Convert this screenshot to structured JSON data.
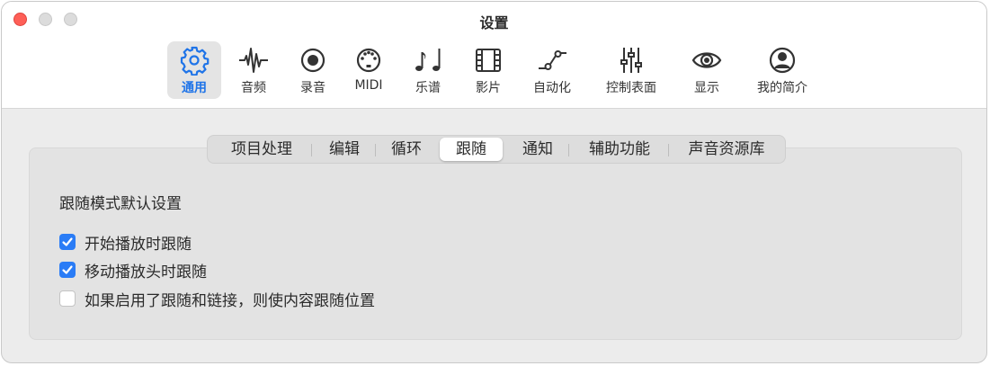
{
  "window": {
    "title": "设置"
  },
  "toolbar": {
    "items": [
      {
        "label": "通用",
        "icon": "gear-icon",
        "active": true
      },
      {
        "label": "音频",
        "icon": "waveform-icon"
      },
      {
        "label": "录音",
        "icon": "record-icon"
      },
      {
        "label": "MIDI",
        "icon": "midi-icon"
      },
      {
        "label": "乐谱",
        "icon": "music-notes-icon"
      },
      {
        "label": "影片",
        "icon": "film-icon"
      },
      {
        "label": "自动化",
        "icon": "automation-icon"
      },
      {
        "label": "控制表面",
        "icon": "sliders-icon"
      },
      {
        "label": "显示",
        "icon": "eye-icon"
      },
      {
        "label": "我的简介",
        "icon": "person-icon"
      }
    ]
  },
  "tabs": {
    "items": [
      "项目处理",
      "编辑",
      "循环",
      "跟随",
      "通知",
      "辅助功能",
      "声音资源库"
    ],
    "selected": "跟随"
  },
  "section": {
    "title": "跟随模式默认设置",
    "options": [
      {
        "label": "开始播放时跟随",
        "checked": true
      },
      {
        "label": "移动播放头时跟随",
        "checked": true
      },
      {
        "label": "如果启用了跟随和链接，则使内容跟随位置",
        "checked": false
      }
    ]
  },
  "colors": {
    "accent": "#1f74e8",
    "checkbox": "#2a7cf6",
    "close": "#fe5f57"
  }
}
